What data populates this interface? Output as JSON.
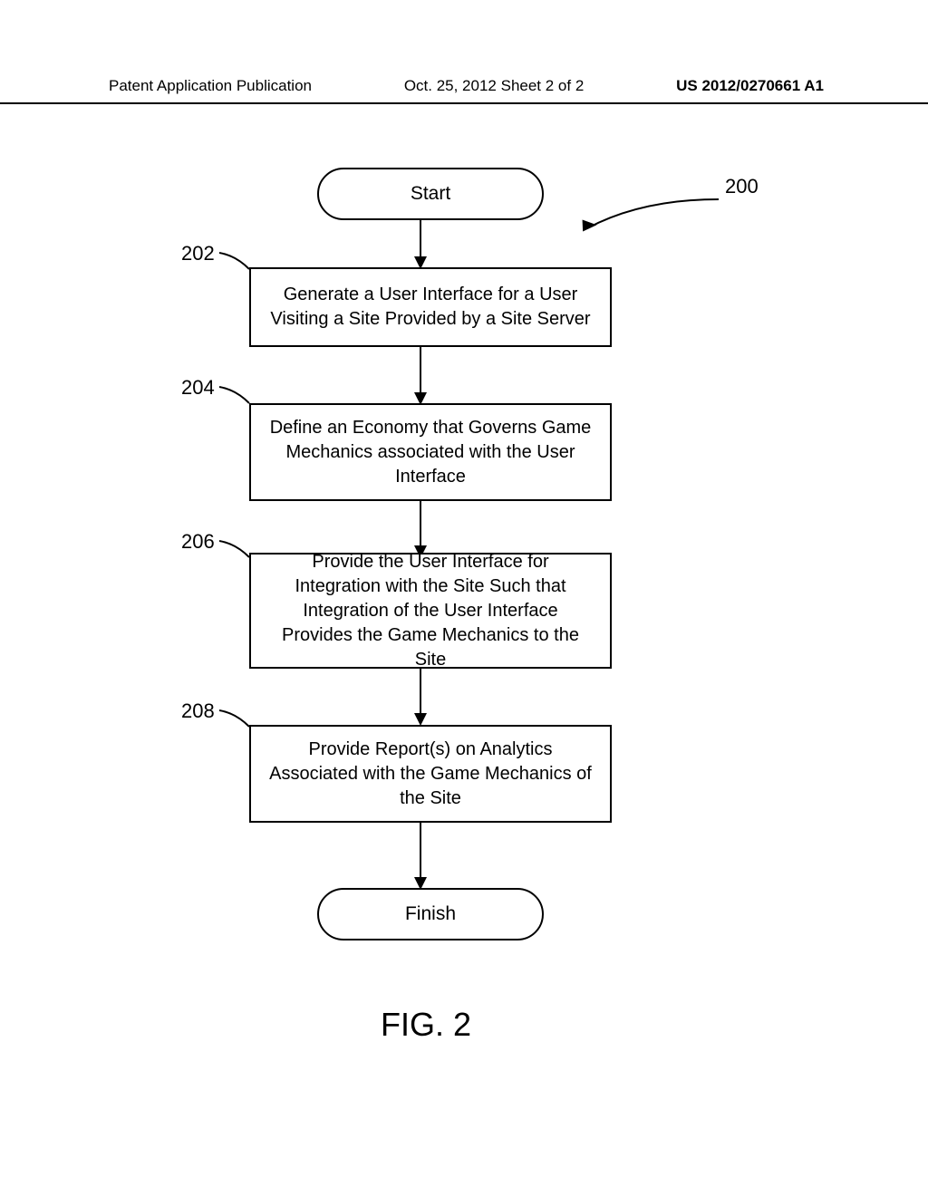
{
  "header": {
    "left": "Patent Application Publication",
    "center": "Oct. 25, 2012  Sheet 2 of 2",
    "right": "US 2012/0270661 A1"
  },
  "flowchart": {
    "start": "Start",
    "step1": "Generate a User Interface for a User Visiting a Site Provided by a Site Server",
    "step2": "Define an Economy that Governs Game Mechanics associated with the User Interface",
    "step3": "Provide the User Interface for Integration with the Site Such that Integration of the User Interface Provides the Game Mechanics to the Site",
    "step4": "Provide Report(s) on Analytics Associated with the Game Mechanics of the Site",
    "finish": "Finish"
  },
  "labels": {
    "ref200": "200",
    "ref202": "202",
    "ref204": "204",
    "ref206": "206",
    "ref208": "208"
  },
  "figure": "FIG. 2"
}
